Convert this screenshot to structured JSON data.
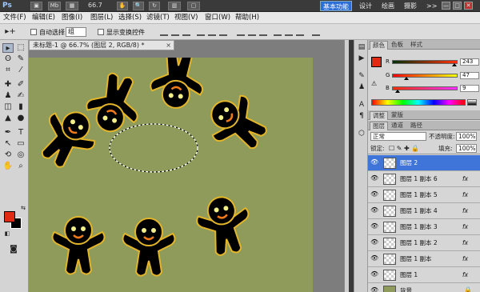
{
  "app": {
    "logo": "Ps",
    "zoom": "66.7",
    "mb_btn": "Mb",
    "workspace_buttons": [
      "基本功能",
      "设计",
      "绘画",
      "摄影",
      ">>"
    ],
    "active_workspace": "基本功能",
    "window_controls": [
      "—",
      "□",
      "✕"
    ]
  },
  "menu": [
    "文件(F)",
    "编辑(E)",
    "图像(I)",
    "图层(L)",
    "选择(S)",
    "滤镜(T)",
    "视图(V)",
    "窗口(W)",
    "帮助(H)"
  ],
  "options": {
    "auto_select_label": "自动选择:",
    "auto_select_value": "组",
    "transform_label": "显示变换控件"
  },
  "document": {
    "tab_title": "未标题-1 @ 66.7% (图层 2, RGB/8) *",
    "close": "×",
    "canvas_color": "#8e9b5a"
  },
  "colors": {
    "foreground": "#e02a14",
    "background": "#000000"
  },
  "color_panel": {
    "tabs": [
      "颜色",
      "色板",
      "样式"
    ],
    "active_tab": "颜色",
    "channels": [
      {
        "label": "R",
        "value": "243",
        "level": 0.95
      },
      {
        "label": "G",
        "value": "47",
        "level": 0.18
      },
      {
        "label": "B",
        "value": "9",
        "level": 0.04
      }
    ]
  },
  "adjust_tabs": [
    "调整",
    "蒙版"
  ],
  "layers_panel": {
    "tabs": [
      "图层",
      "通道",
      "路径"
    ],
    "active_tab": "图层",
    "blend_mode": "正常",
    "opacity_label": "不透明度:",
    "opacity_value": "100%",
    "lock_label": "锁定:",
    "fill_label": "填充:",
    "fill_value": "100%",
    "fx_label": "fx",
    "layers": [
      {
        "name": "图层 2",
        "selected": true,
        "fx": false
      },
      {
        "name": "图层 1 副本 6",
        "selected": false,
        "fx": true
      },
      {
        "name": "图层 1 副本 5",
        "selected": false,
        "fx": true
      },
      {
        "name": "图层 1 副本 4",
        "selected": false,
        "fx": true
      },
      {
        "name": "图层 1 副本 3",
        "selected": false,
        "fx": true
      },
      {
        "name": "图层 1 副本 2",
        "selected": false,
        "fx": true
      },
      {
        "name": "图层 1 副本",
        "selected": false,
        "fx": true
      },
      {
        "name": "图层 1",
        "selected": false,
        "fx": true
      },
      {
        "name": "背景",
        "selected": false,
        "fx": false,
        "locked": true
      }
    ]
  }
}
